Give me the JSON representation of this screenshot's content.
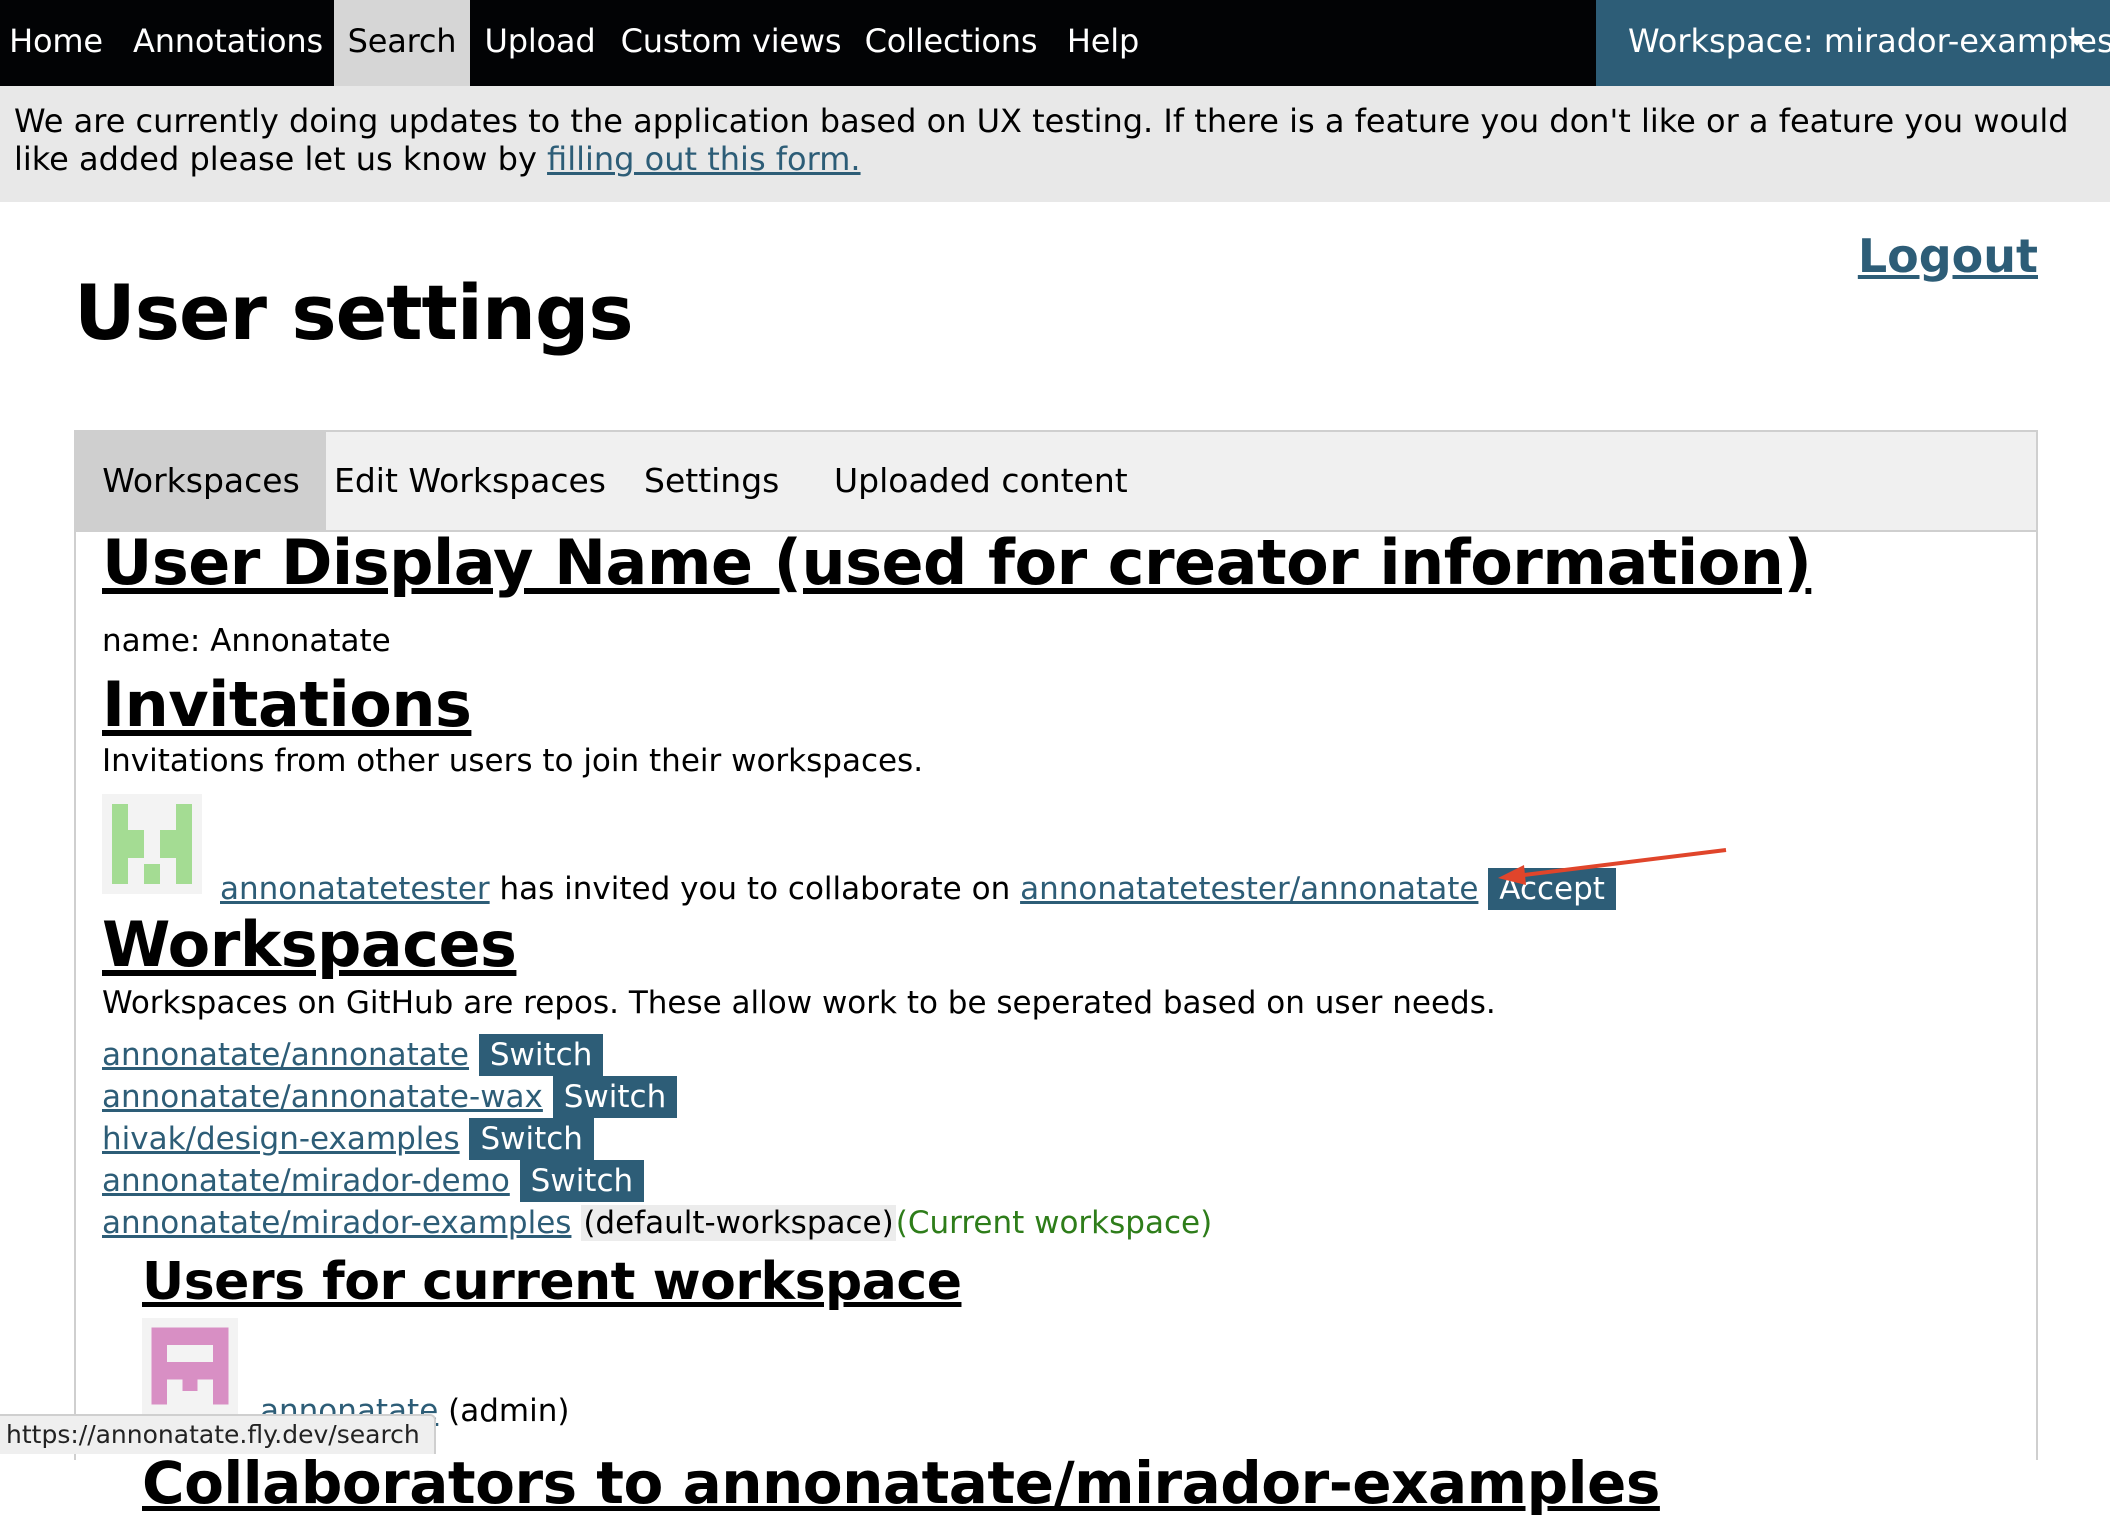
{
  "nav": {
    "items": [
      "Home",
      "Annotations",
      "Search",
      "Upload",
      "Custom views",
      "Collections",
      "Help"
    ],
    "active": "Search",
    "workspace_menu": "Workspace: mirador-examples"
  },
  "notice": {
    "text": "We are currently doing updates to the application based on UX testing. If there is a feature you don't like or a feature you would like added please let us know by ",
    "link": "filling out this form."
  },
  "header": {
    "title": "User settings",
    "logout": "Logout"
  },
  "tabs": [
    "Workspaces",
    "Edit Workspaces",
    "Settings",
    "Uploaded content"
  ],
  "active_tab": "Workspaces",
  "display_name": {
    "heading": "User Display Name (used for creator information)",
    "label": "name: Annonatate"
  },
  "invitations": {
    "heading": "Invitations",
    "description": "Invitations from other users to join their workspaces.",
    "inviter": "annonatatetester",
    "middle_text": " has invited you to collaborate on ",
    "repo": "annonatatetester/annonatate",
    "accept_label": "Accept"
  },
  "workspaces": {
    "heading": "Workspaces",
    "description": "Workspaces on GitHub are repos. These allow work to be seperated based on user needs.",
    "switch_label": "Switch",
    "items": [
      {
        "name": "annonatate/annonatate"
      },
      {
        "name": "annonatate/annonatate-wax"
      },
      {
        "name": "hivak/design-examples"
      },
      {
        "name": "annonatate/mirador-demo"
      }
    ],
    "current": {
      "name": "annonatate/mirador-examples",
      "tag": "(default-workspace)",
      "status": "(Current workspace)"
    }
  },
  "users": {
    "heading": "Users for current workspace",
    "user": "annonatate",
    "role": " (admin)"
  },
  "collaborators_heading_partial": "Collaborators to annonatate/mirador-examples",
  "status_bar": "https://annonatate.fly.dev/search",
  "colors": {
    "nav_bg": "#020305",
    "accent": "#2d5d77",
    "notice_bg": "#e8e8e8",
    "current_green": "#2e7d1a",
    "annotation_arrow": "#e0452b"
  }
}
